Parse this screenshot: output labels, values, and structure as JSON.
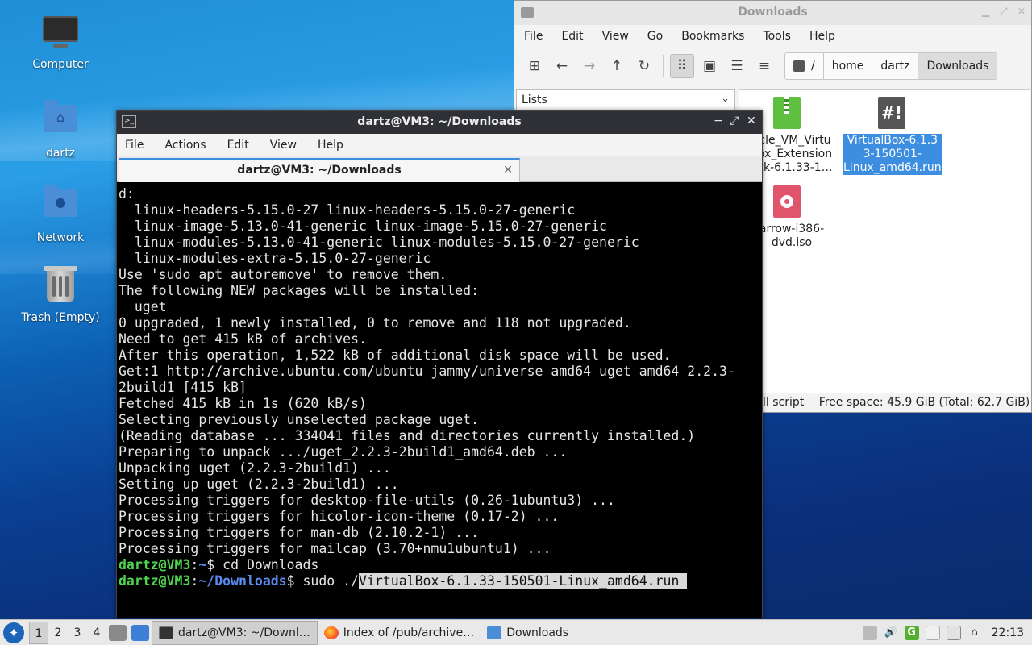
{
  "desktop": {
    "icons": [
      {
        "label": "Computer"
      },
      {
        "label": "dartz"
      },
      {
        "label": "Network"
      },
      {
        "label": "Trash (Empty)"
      }
    ]
  },
  "file_manager": {
    "title": "Downloads",
    "menu": [
      "File",
      "Edit",
      "View",
      "Go",
      "Bookmarks",
      "Tools",
      "Help"
    ],
    "breadcrumbs": [
      "/",
      "home",
      "dartz",
      "Downloads"
    ],
    "side_pane_mode": "Lists",
    "files": [
      {
        "name": "cle_VM_Virtu\nox_Extension\nck-6.1.33-1…",
        "type": "archive",
        "selected": false
      },
      {
        "name": "VirtualBox-6.1.3\n3-150501-\nLinux_amd64.run",
        "type": "script",
        "selected": true
      },
      {
        "name": "arrow-i386-\ndvd.iso",
        "type": "disc",
        "selected": false
      }
    ],
    "status_left": "ll script",
    "status_right": "Free space: 45.9 GiB (Total: 62.7 GiB)"
  },
  "terminal": {
    "title": "dartz@VM3: ~/Downloads",
    "menu": [
      "File",
      "Actions",
      "Edit",
      "View",
      "Help"
    ],
    "tab_label": "dartz@VM3: ~/Downloads",
    "lines": [
      "d:",
      "  linux-headers-5.15.0-27 linux-headers-5.15.0-27-generic",
      "  linux-image-5.13.0-41-generic linux-image-5.15.0-27-generic",
      "  linux-modules-5.13.0-41-generic linux-modules-5.15.0-27-generic",
      "  linux-modules-extra-5.15.0-27-generic",
      "Use 'sudo apt autoremove' to remove them.",
      "The following NEW packages will be installed:",
      "  uget",
      "0 upgraded, 1 newly installed, 0 to remove and 118 not upgraded.",
      "Need to get 415 kB of archives.",
      "After this operation, 1,522 kB of additional disk space will be used.",
      "Get:1 http://archive.ubuntu.com/ubuntu jammy/universe amd64 uget amd64 2.2.3-",
      "2build1 [415 kB]",
      "Fetched 415 kB in 1s (620 kB/s)",
      "Selecting previously unselected package uget.",
      "(Reading database ... 334041 files and directories currently installed.)",
      "Preparing to unpack .../uget_2.2.3-2build1_amd64.deb ...",
      "Unpacking uget (2.2.3-2build1) ...",
      "Setting up uget (2.2.3-2build1) ...",
      "Processing triggers for desktop-file-utils (0.26-1ubuntu3) ...",
      "Processing triggers for hicolor-icon-theme (0.17-2) ...",
      "Processing triggers for man-db (2.10.2-1) ...",
      "Processing triggers for mailcap (3.70+nmu1ubuntu1) ..."
    ],
    "prompt1": {
      "user": "dartz@VM3",
      "sep": ":",
      "path": "~",
      "symbol": "$ ",
      "command": "cd Downloads"
    },
    "prompt2": {
      "user": "dartz@VM3",
      "sep": ":",
      "path": "~/Downloads",
      "symbol": "$ ",
      "command_prefix": "sudo ./",
      "command_selected": "VirtualBox-6.1.33-150501-Linux_amd64.run "
    }
  },
  "taskbar": {
    "workspaces": [
      "1",
      "2",
      "3",
      "4"
    ],
    "tasks": [
      {
        "label": "dartz@VM3: ~/Downl…",
        "icon": "terminal-icon",
        "active": true
      },
      {
        "label": "Index of /pub/archive…",
        "icon": "firefox-icon",
        "active": false
      },
      {
        "label": "Downloads",
        "icon": "folder-icon",
        "active": false
      }
    ],
    "clock": "22:13"
  },
  "colors": {
    "selection": "#3d8ee0",
    "prompt_user": "#4fd44f",
    "prompt_path": "#5a8cf0"
  }
}
